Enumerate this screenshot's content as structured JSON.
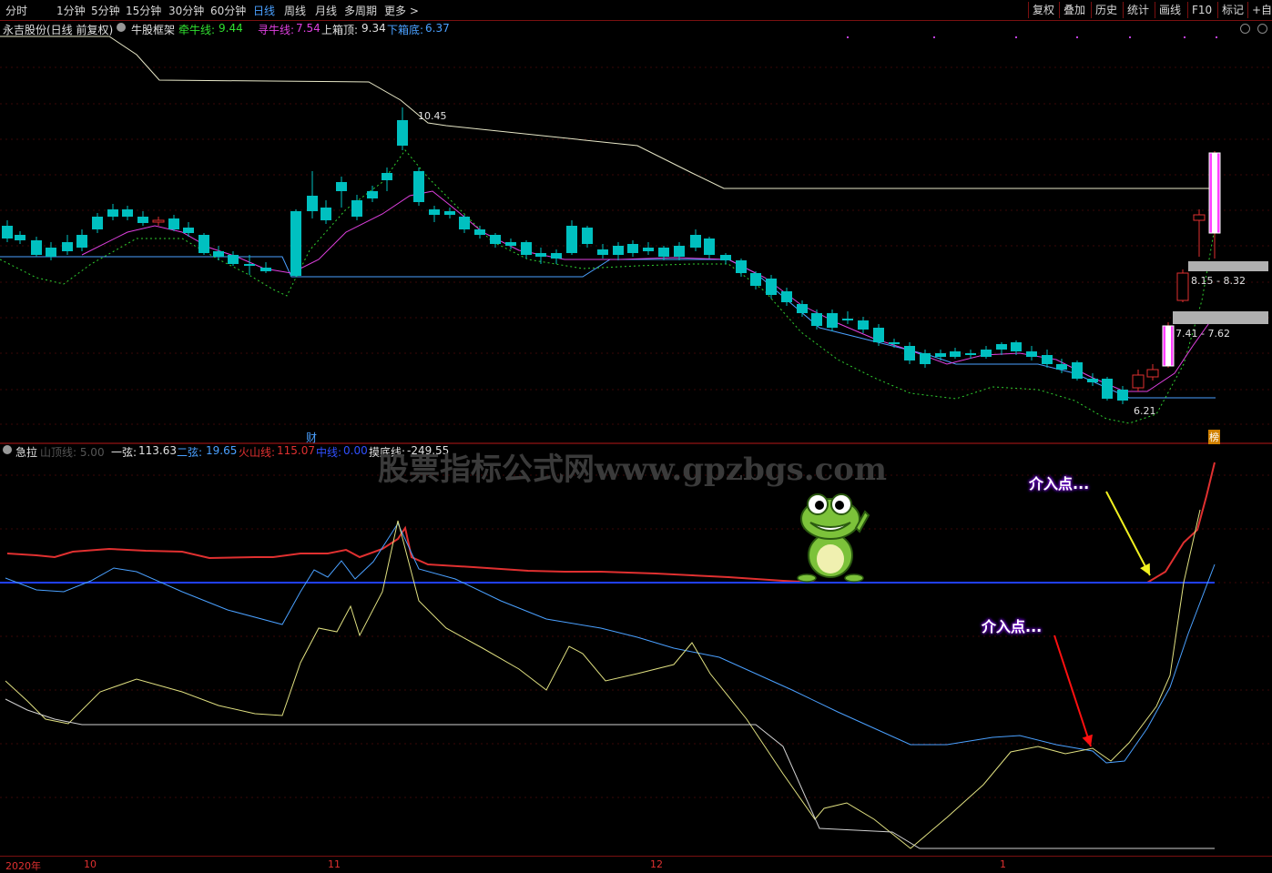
{
  "toolbar": {
    "periods": [
      "分时",
      "1分钟",
      "5分钟",
      "15分钟",
      "30分钟",
      "60分钟",
      "日线",
      "周线",
      "月线",
      "多周期",
      "更多 >"
    ],
    "active_period": "日线",
    "right_buttons": [
      "复权",
      "叠加",
      "历史",
      "统计",
      "画线",
      "F10",
      "标记",
      "+自选"
    ]
  },
  "main_legend": {
    "stock": "永吉股份(日线 前复权)",
    "indicator": "牛股框架",
    "line1_label": "牵牛线:",
    "line1_value": "9.44",
    "line2_label": "寻牛线:",
    "line2_value": "7.54",
    "top_label": "上箱顶:",
    "top_value": "9.34",
    "bottom_label": "下箱底:",
    "bottom_value": "6.37"
  },
  "annotations": {
    "high": "10.45",
    "low": "6.21",
    "box1": "8.15 - 8.32",
    "box2": "7.41 - 7.62",
    "cai": "财",
    "bang": "榜"
  },
  "sub_legend": {
    "name": "急拉",
    "param1": "山顶线: 5.00",
    "yixian_label": "一弦:",
    "yixian_value": "113.63",
    "erxian_label": "二弦:",
    "erxian_value": "19.65",
    "huoshan_label": "火山线:",
    "huoshan_value": "115.07",
    "zhongxian_label": "中线:",
    "zhongxian_value": "0.00",
    "modi_label": "摸底线:",
    "modi_value": "-249.55"
  },
  "watermark": "股票指标公式网www.gpzbgs.com",
  "callouts": [
    "介入点...",
    "介入点..."
  ],
  "xaxis": {
    "year": "2020年",
    "months": [
      "10",
      "11",
      "12",
      "1"
    ]
  },
  "colors": {
    "up": "#e03030",
    "down": "#00c0c0",
    "accent": "#4aa0ff",
    "border": "#7a1010"
  }
}
